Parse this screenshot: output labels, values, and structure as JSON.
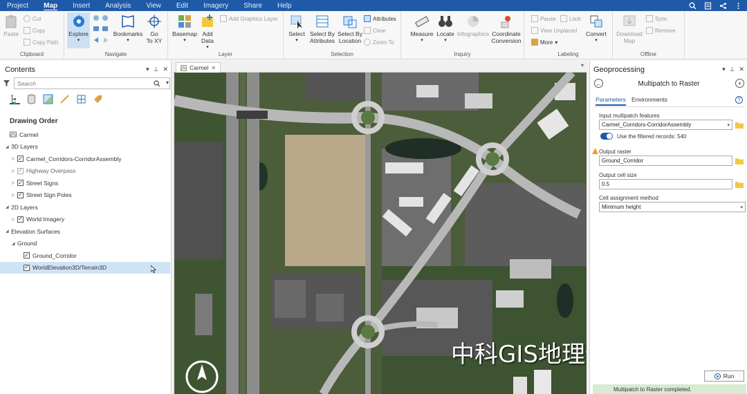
{
  "menu": {
    "tabs": [
      "Project",
      "Map",
      "Insert",
      "Analysis",
      "View",
      "Edit",
      "Imagery",
      "Share",
      "Help"
    ],
    "active_tab": "Map"
  },
  "ribbon": {
    "clipboard": {
      "label": "Clipboard",
      "paste": "Paste",
      "cut": "Cut",
      "copy": "Copy",
      "copy_path": "Copy Path"
    },
    "navigate": {
      "label": "Navigate",
      "explore": "Explore",
      "bookmarks": "Bookmarks",
      "goto_line1": "Go",
      "goto_line2": "To XY"
    },
    "layer": {
      "label": "Layer",
      "basemap": "Basemap",
      "add_data_line1": "Add",
      "add_data_line2": "Data",
      "add_graphics": "Add Graphics Layer"
    },
    "selection": {
      "label": "Selection",
      "select": "Select",
      "select_by_attr_line1": "Select By",
      "select_by_attr_line2": "Attributes",
      "select_by_loc_line1": "Select By",
      "select_by_loc_line2": "Location",
      "attributes": "Attributes",
      "clear": "Clear",
      "zoom_to": "Zoom To"
    },
    "inquiry": {
      "label": "Inquiry",
      "measure": "Measure",
      "locate": "Locate",
      "infographics": "Infographics",
      "coord_line1": "Coordinate",
      "coord_line2": "Conversion"
    },
    "labeling": {
      "label": "Labeling",
      "pause": "Pause",
      "lock": "Lock",
      "view_unplaced": "View Unplaced",
      "more": "More",
      "convert": "Convert"
    },
    "offline": {
      "label": "Offline",
      "download_line1": "Download",
      "download_line2": "Map",
      "sync": "Sync",
      "remove": "Remove"
    }
  },
  "contents": {
    "title": "Contents",
    "search_placeholder": "Search",
    "drawing_order": "Drawing Order",
    "tree": [
      {
        "label": "Carmel",
        "indent": 0,
        "type": "map"
      },
      {
        "label": "3D Layers",
        "indent": 0,
        "type": "group"
      },
      {
        "label": "Carmel_Corridors-CorridorAssembly",
        "indent": 1,
        "type": "layer",
        "checked": true
      },
      {
        "label": "Highway Overpass",
        "indent": 1,
        "type": "layer",
        "checked": true,
        "dim": true
      },
      {
        "label": "Street Signs",
        "indent": 1,
        "type": "layer",
        "checked": true
      },
      {
        "label": "Street Sign Poles",
        "indent": 1,
        "type": "layer",
        "checked": true
      },
      {
        "label": "2D Layers",
        "indent": 0,
        "type": "group"
      },
      {
        "label": "World Imagery",
        "indent": 1,
        "type": "layer",
        "checked": true
      },
      {
        "label": "Elevation Surfaces",
        "indent": 0,
        "type": "group"
      },
      {
        "label": "Ground",
        "indent": 1,
        "type": "group"
      },
      {
        "label": "Ground_Corridor",
        "indent": 2,
        "type": "layer",
        "checked": true
      },
      {
        "label": "WorldElevation3D/Terrain3D",
        "indent": 2,
        "type": "layer",
        "checked": true,
        "selected": true
      }
    ]
  },
  "map": {
    "tab_label": "Carmel",
    "watermark": "中科GIS地理信息培训"
  },
  "geoprocessing": {
    "title": "Geoprocessing",
    "tool_title": "Multipatch to Raster",
    "tabs": [
      "Parameters",
      "Environments"
    ],
    "input_label": "Input multipatch features",
    "input_value": "Carmel_Corridors-CorridorAssembly",
    "filtered_records": "Use the filtered records: 540",
    "output_label": "Output raster",
    "output_value": "Ground_Corridor",
    "cell_size_label": "Output cell size",
    "cell_size_value": "0.5",
    "method_label": "Cell assignment method",
    "method_value": "Minimum height",
    "run_label": "Run",
    "status": "Multipatch to Raster completed."
  },
  "colors": {
    "accent": "#1f5aa8",
    "selected_row": "#cfe3f7",
    "status_ok": "#d8ead2"
  }
}
